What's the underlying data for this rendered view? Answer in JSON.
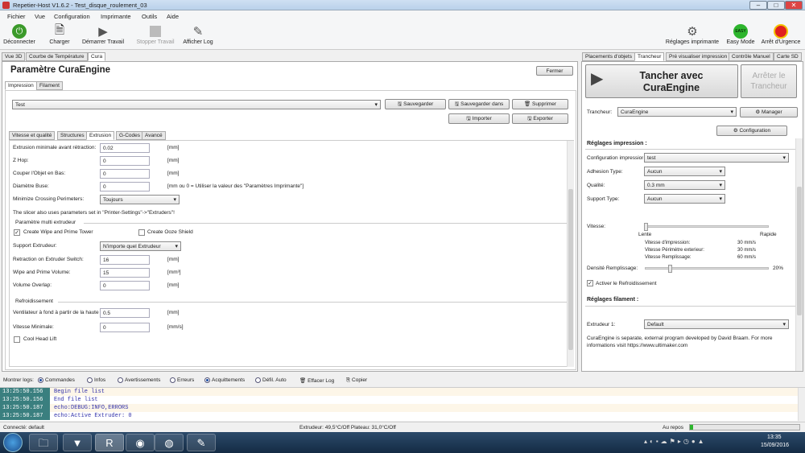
{
  "window": {
    "title": "Repetier-Host V1.6.2 - Test_disque_roulement_03"
  },
  "menu": [
    "Fichier",
    "Vue",
    "Configuration",
    "Imprimante",
    "Outils",
    "Aide"
  ],
  "toolbar": {
    "disconnect": "Déconnecter",
    "load": "Charger",
    "start": "Démarrer Travail",
    "stop": "Stopper Travail",
    "log": "Afficher Log",
    "printer_settings": "Réglages imprimante",
    "easy_mode": "Easy Mode",
    "easy_badge": "EASY",
    "emergency": "Arrêt d'Urgence"
  },
  "left_tabs": [
    "Vue 3D",
    "Courbe de Température",
    "Cura"
  ],
  "cura": {
    "title": "Paramètre CuraEngine",
    "close": "Fermer",
    "subtabs": [
      "Impression",
      "Filament"
    ],
    "profile": "Test",
    "save": "Sauvegarder",
    "save_as": "Sauvegarder dans",
    "delete": "Supprimer",
    "import": "Importer",
    "export": "Exporter",
    "tabs": [
      "Vitesse et qualité",
      "Structures",
      "Extrusion",
      "G-Codes",
      "Avancé"
    ],
    "fields": {
      "min_extrusion_label": "Extrusion minimale avant rétraction:",
      "min_extrusion": "0.02",
      "zhop_label": "Z Hop:",
      "zhop": "0",
      "cut_label": "Couper l'Objet en Bas:",
      "cut": "0",
      "nozzle_label": "Diamètre Buse:",
      "nozzle": "0",
      "nozzle_hint": "[mm ou 0 = Utiliser la valeur des \"Paramètres Imprimante\"]",
      "crossing_label": "Minimize Crossing Perimeters:",
      "crossing": "Toujours",
      "note": "The slicer also uses parameters set in \"Printer-Settings\"->\"Extruders\"!",
      "unit_mm": "[mm]",
      "unit_mm3": "[mm³]",
      "unit_mms": "[mm/s]"
    },
    "multi": {
      "title": "Paramètre multi extrudeur",
      "wipe": "Create Wipe and Prime Tower",
      "ooze": "Create Ooze Shield",
      "support_label": "Support Extrudeur:",
      "support": "N'importe quel Extrudeur",
      "retraction_label": "Retraction on Extruder Switch:",
      "retraction": "16",
      "wipe_vol_label": "Wipe and Prime Volume:",
      "wipe_vol": "15",
      "overlap_label": "Volume Overlap:",
      "overlap": "0"
    },
    "cooling": {
      "title": "Refroidissement",
      "fan_label": "Ventilateur à fond à partir de la hauteur:",
      "fan": "0.5",
      "min_speed_label": "Vitesse Minimale:",
      "min_speed": "0",
      "cool_head": "Cool Head Lift"
    }
  },
  "right_tabs": [
    "Placements d'objets",
    "Trancheur",
    "Pré visualiser impression",
    "Contrôle Manuel",
    "Carte SD"
  ],
  "slicer": {
    "slice_btn": "Tracher avec CuraEngine",
    "slice_line1": "Tancher avec",
    "slice_line2": "CuraEngine",
    "stop_line1": "Arrêter le",
    "stop_line2": "Trancheur",
    "slicer_label": "Trancheur:",
    "slicer": "CuraEngine",
    "manager": "Manager",
    "configuration": "Configuration",
    "print_settings": "Réglages impression :",
    "print_config_label": "Configuration impression:",
    "print_config": "test",
    "adhesion_label": "Adhesion Type:",
    "adhesion": "Aucun",
    "quality_label": "Qualité:",
    "quality": "0.3 mm",
    "support_label": "Support Type:",
    "support": "Aucun",
    "speed_label": "Vitesse:",
    "slow": "Lente",
    "fast": "Rapide",
    "print_speed_label": "Vitesse d'impression:",
    "print_speed": "30 mm/s",
    "outer_label": "Vitesse Périmètre exterieur:",
    "outer": "30 mm/s",
    "infill_speed_label": "Vitesse Remplissage:",
    "infill_speed": "60 mm/s",
    "density_label": "Densité Remplissage:",
    "density": "20%",
    "density_value": 0.2,
    "cooling": "Activer le Refroidissement",
    "filament_settings": "Réglages filament :",
    "extruder_label": "Extrudeur 1:",
    "extruder": "Default",
    "info": "CuraEngine is separate, external program developed by David Braam. For more informations visit https://www.ultimaker.com"
  },
  "log": {
    "label": "Montrer logs:",
    "filters": [
      "Commandes",
      "Infos",
      "Avertissements",
      "Erreurs",
      "Acquittements",
      "Défil. Auto"
    ],
    "clear": "Effacer Log",
    "copy": "Copier",
    "rows": [
      {
        "time": "13:25:50.156",
        "msg": "Begin file list"
      },
      {
        "time": "13:25:50.156",
        "msg": "End file list"
      },
      {
        "time": "13:25:50.187",
        "msg": "echo:DEBUG:INFO,ERRORS"
      },
      {
        "time": "13:25:50.187",
        "msg": "echo:Active Extruder: 0"
      }
    ]
  },
  "status": {
    "connected": "Connecté: default",
    "temps": "Extrudeur: 49,5°C/Off Plateau: 31,0°C/Off",
    "idle": "Au repos"
  },
  "taskbar": {
    "time": "13:35",
    "date": "15/09/2016"
  },
  "colors": {
    "accent": "#3a7f7f",
    "easy": "#2db52d",
    "stop": "#e02020"
  }
}
